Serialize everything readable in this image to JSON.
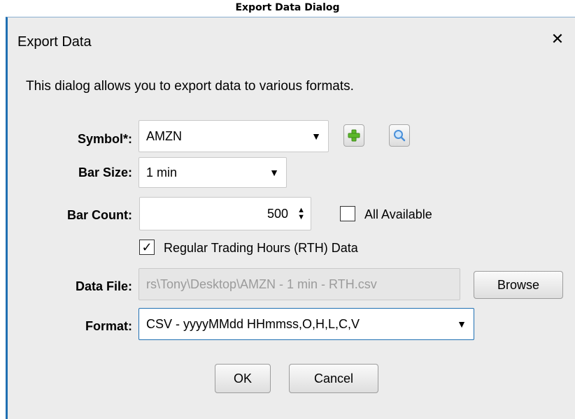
{
  "caption": "Export Data Dialog",
  "dialog": {
    "title": "Export Data",
    "close_glyph": "✕",
    "description": "This dialog allows you to export data to various formats."
  },
  "fields": {
    "symbol": {
      "label": "Symbol*:",
      "value": "AMZN"
    },
    "bar_size": {
      "label": "Bar Size:",
      "value": "1 min"
    },
    "bar_count": {
      "label": "Bar Count:",
      "value": "500"
    },
    "all_available": {
      "label": "All Available",
      "checked": false
    },
    "rth": {
      "label": "Regular Trading Hours (RTH) Data",
      "checked": true
    },
    "data_file": {
      "label": "Data File:",
      "value": "rs\\Tony\\Desktop\\AMZN - 1 min - RTH.csv"
    },
    "format": {
      "label": "Format:",
      "value": "CSV - yyyyMMdd HHmmss,O,H,L,C,V"
    }
  },
  "buttons": {
    "browse": "Browse",
    "ok": "OK",
    "cancel": "Cancel"
  },
  "icons": {
    "add_symbol": "add-symbol-icon",
    "search_symbol": "search-symbol-icon",
    "dropdown": "chevron-down-icon",
    "checkmark": "✓"
  },
  "colors": {
    "window_border": "#1f6fb2",
    "add_icon": "#5cb82a",
    "search_icon": "#4a90d9"
  }
}
